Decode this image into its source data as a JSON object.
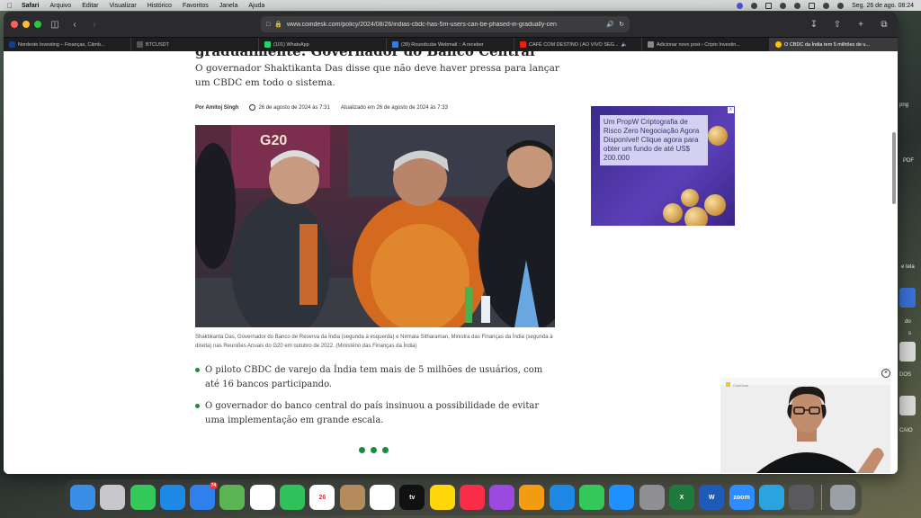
{
  "menubar": {
    "app": "Safari",
    "items": [
      "Arquivo",
      "Editar",
      "Visualizar",
      "Histórico",
      "Favoritos",
      "Janela",
      "Ajuda"
    ],
    "datetime": "Seg. 26 de ago.  08:24"
  },
  "browser": {
    "url": "www.coindesk.com/policy/2024/08/26/indias-cbdc-has-5m-users-can-be-phased-in-gradually-cen",
    "tabs": [
      {
        "label": "Nordeste Investing – Finanças, Câmb...",
        "color": "#1b3a8a"
      },
      {
        "label": "BTCUSDT",
        "color": "#222"
      },
      {
        "label": "(101) WhatsApp",
        "color": "#25d366"
      },
      {
        "label": "(39) Roundcube Webmail :: A receber",
        "color": "#3a7bd5"
      },
      {
        "label": "CAFÉ COM DESTINO | AO VIVO SEG...",
        "color": "#e62117"
      },
      {
        "label": "Adicionar novo post ‹ Cripto Investin...",
        "color": "#444"
      },
      {
        "label": "O CBDC da Índia tem 5 milhões de u...",
        "color": "#f5c518"
      }
    ]
  },
  "article": {
    "headline_partial": "gradualmente: Governador do Banco Central",
    "subheadline": "O governador Shaktikanta Das disse que não deve haver pressa para lançar um CBDC em todo o sistema.",
    "author": "Por Amitoj Singh",
    "published": "26 de agosto de 2024 às 7:31",
    "updated": "Atualizado em 26 de agosto de 2024 às 7:33",
    "caption": "Shaktikanta Das, Governador do Banco de Reserva da Índia (segunda à esquerda) e Nirmala Sitharaman, Ministra das Finanças da Índia (segunda à direita) nas Reuniões Anuais do G20 em outubro de 2022. (Ministério das Finanças da Índia)",
    "photo_banner": "G20",
    "bullets": [
      "O piloto CBDC de varejo da Índia tem mais de 5 milhões de usuários, com até 16 bancos participando.",
      "O governador do banco central do país insinuou a possibilidade de evitar uma implementação em grande escala."
    ]
  },
  "ad": {
    "text": "Um PropW Criptografia de Risco Zero Negociação Agora Disponível! Clique agora para obter um fundo de até US$ 200.000",
    "close": "x"
  },
  "video": {
    "close": "×",
    "label": "CoinDesk"
  },
  "desktop_labels": [
    "png",
    "PDF",
    "e tela",
    "do",
    "s",
    "DOS",
    "CAIO"
  ],
  "dock": [
    {
      "name": "finder",
      "color": "#3a8ee6",
      "label": ""
    },
    {
      "name": "launchpad",
      "color": "#c7c7cc",
      "label": ""
    },
    {
      "name": "messages",
      "color": "#34c759",
      "label": ""
    },
    {
      "name": "safari",
      "color": "#1e88e5",
      "label": ""
    },
    {
      "name": "mail",
      "color": "#2f80ed",
      "label": "",
      "badge": "74"
    },
    {
      "name": "maps",
      "color": "#5ab552",
      "label": ""
    },
    {
      "name": "photos",
      "color": "#ffffff",
      "label": ""
    },
    {
      "name": "facetime",
      "color": "#30c15a",
      "label": ""
    },
    {
      "name": "calendar",
      "color": "#ffffff",
      "label": "26"
    },
    {
      "name": "contacts",
      "color": "#b38b5d",
      "label": ""
    },
    {
      "name": "reminders",
      "color": "#ffffff",
      "label": ""
    },
    {
      "name": "tv",
      "color": "#111111",
      "label": "tv"
    },
    {
      "name": "notes",
      "color": "#ffd60a",
      "label": ""
    },
    {
      "name": "music",
      "color": "#fa2d48",
      "label": ""
    },
    {
      "name": "podcasts",
      "color": "#9b4ae0",
      "label": ""
    },
    {
      "name": "pages",
      "color": "#f39c12",
      "label": ""
    },
    {
      "name": "keynote",
      "color": "#1e88e5",
      "label": ""
    },
    {
      "name": "numbers",
      "color": "#34c759",
      "label": ""
    },
    {
      "name": "app-store",
      "color": "#1e90ff",
      "label": ""
    },
    {
      "name": "system-settings",
      "color": "#8e8e93",
      "label": ""
    },
    {
      "name": "excel",
      "color": "#1f7a3e",
      "label": "X"
    },
    {
      "name": "word",
      "color": "#1e5bb8",
      "label": "W"
    },
    {
      "name": "zoom",
      "color": "#2d8cff",
      "label": "zoom"
    },
    {
      "name": "telegram",
      "color": "#2aa3df",
      "label": ""
    },
    {
      "name": "calculator",
      "color": "#5a5a5e",
      "label": ""
    },
    {
      "name": "trash",
      "color": "#9aa0a6",
      "label": ""
    }
  ]
}
